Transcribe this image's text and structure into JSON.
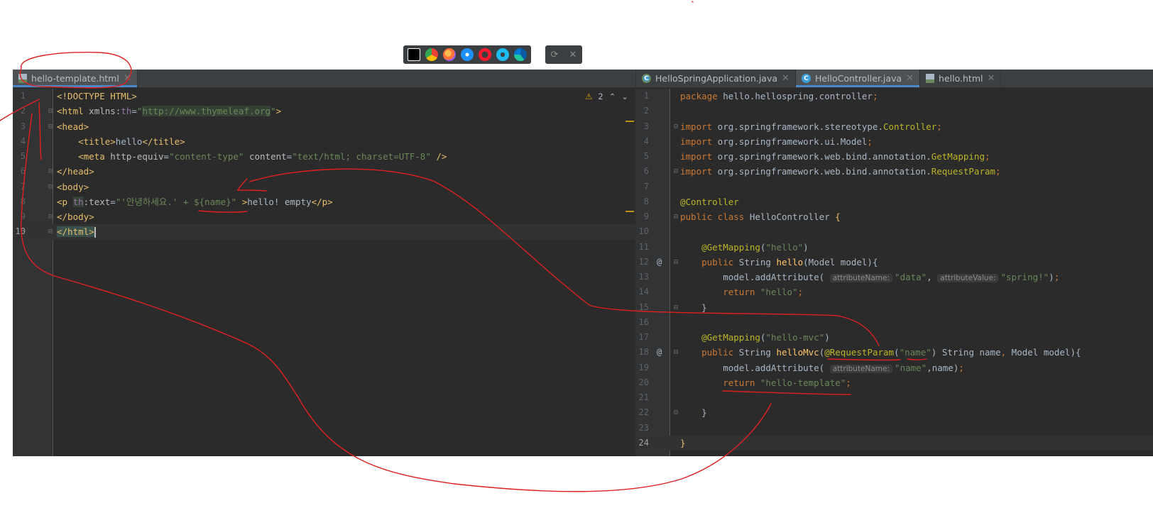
{
  "left_pane": {
    "tabs": [
      {
        "label": "hello-template.html",
        "icon": "html-file-icon",
        "active": true
      }
    ],
    "inspection": {
      "warning_count": "2"
    },
    "lines": [
      {
        "n": "1",
        "html": "<span class='tag'>&lt;!DOCTYPE HTML&gt;</span>"
      },
      {
        "n": "2",
        "html": "<span class='tag'>&lt;html</span> <span class='attr'>xmlns:</span><span class='ns'>th</span>=<span class='str'>\"<span class='hl-green'>http://www.thymeleaf.org</span>\"</span><span class='tag'>&gt;</span>"
      },
      {
        "n": "3",
        "html": "<span class='tag'>&lt;head&gt;</span>"
      },
      {
        "n": "4",
        "html": "    <span class='tag'>&lt;title&gt;</span>hello<span class='tag'>&lt;/title&gt;</span>"
      },
      {
        "n": "5",
        "html": "    <span class='tag'>&lt;meta</span> <span class='attr'>http-equiv</span>=<span class='str'>\"content-type\"</span> <span class='attr'>content</span>=<span class='str'>\"text/html; charset=UTF-8\"</span> <span class='tag'>/&gt;</span>"
      },
      {
        "n": "6",
        "html": "<span class='tag'>&lt;/head&gt;</span>"
      },
      {
        "n": "7",
        "html": "<span class='tag'>&lt;body&gt;</span>"
      },
      {
        "n": "8",
        "html": "<span class='tag'>&lt;p</span> <span class='ns hl-green'>th</span><span class='attr'>:text</span>=<span class='str'>\"'안녕하세요.' + ${name}\"</span> <span class='tag'>&gt;</span>hello! empty<span class='tag'>&lt;/p&gt;</span>"
      },
      {
        "n": "9",
        "html": "<span class='tag'>&lt;/body&gt;</span>"
      },
      {
        "n": "10",
        "html": "<span class='tag hl-name'>&lt;/html&gt;</span><span class='caret'></span>",
        "current": true
      }
    ]
  },
  "right_pane": {
    "tabs": [
      {
        "label": "HelloSpringApplication.java",
        "icon": "spring-app-icon",
        "active": false
      },
      {
        "label": "HelloController.java",
        "icon": "java-class-icon",
        "active": true
      },
      {
        "label": "hello.html",
        "icon": "html-file-icon",
        "active": false
      }
    ],
    "lines": [
      {
        "n": "1",
        "html": "<span class='kw'>package</span> hello.hellospring.controller<span class='kw'>;</span>"
      },
      {
        "n": "2",
        "html": ""
      },
      {
        "n": "3",
        "html": "<span class='kw'>import</span> org.springframework.stereotype.<span class='ann'>Controller</span><span class='kw'>;</span>"
      },
      {
        "n": "4",
        "html": "<span class='kw'>import</span> org.springframework.ui.Model<span class='kw'>;</span>"
      },
      {
        "n": "5",
        "html": "<span class='kw'>import</span> org.springframework.web.bind.annotation.<span class='ann'>GetMapping</span><span class='kw'>;</span>"
      },
      {
        "n": "6",
        "html": "<span class='kw'>import</span> org.springframework.web.bind.annotation.<span class='ann'>RequestParam</span><span class='kw'>;</span>"
      },
      {
        "n": "7",
        "html": ""
      },
      {
        "n": "8",
        "html": "<span class='ann'>@Controller</span>"
      },
      {
        "n": "9",
        "html": "<span class='kw'>public class</span> HelloController <span class='tag'>{</span>"
      },
      {
        "n": "10",
        "html": ""
      },
      {
        "n": "11",
        "html": "    <span class='ann'>@GetMapping</span>(<span class='str'>\"hello\"</span>)"
      },
      {
        "n": "12",
        "html": "    <span class='kw'>public</span> String <span style='color:#ffc66d'>hello</span>(Model model){",
        "at": true
      },
      {
        "n": "13",
        "html": "        model.addAttribute( <span class='hint'>attributeName:</span><span class='str'>\"data\"</span>, <span class='hint'>attributeValue:</span><span class='str'>\"spring!\"</span>)<span class='kw'>;</span>"
      },
      {
        "n": "14",
        "html": "        <span class='kw'>return</span> <span class='str'>\"hello\"</span><span class='kw'>;</span>"
      },
      {
        "n": "15",
        "html": "    }"
      },
      {
        "n": "16",
        "html": ""
      },
      {
        "n": "17",
        "html": "    <span class='ann'>@GetMapping</span>(<span class='str'>\"hello-mvc\"</span>)"
      },
      {
        "n": "18",
        "html": "    <span class='kw'>public</span> String <span style='color:#ffc66d'>helloMvc</span>(<span class='ann'>@RequestParam</span>(<span class='str'>\"name\"</span>) String name<span class='kw'>,</span> Model model){",
        "at": true
      },
      {
        "n": "19",
        "html": "        model.addAttribute( <span class='hint'>attributeName:</span><span class='str'>\"name\"</span>,name)<span class='kw'>;</span>"
      },
      {
        "n": "20",
        "html": "        <span class='kw'>return</span> <span class='str'>\"hello-template\"</span><span class='kw'>;</span>"
      },
      {
        "n": "21",
        "html": ""
      },
      {
        "n": "22",
        "html": "    }"
      },
      {
        "n": "23",
        "html": ""
      },
      {
        "n": "24",
        "html": "<span class='tag'>}</span>",
        "current": true
      }
    ]
  },
  "browser_icons": [
    "intellij-icon",
    "chrome-icon",
    "firefox-icon",
    "safari-icon",
    "opera-icon",
    "ie-icon",
    "edge-icon"
  ],
  "colors": {
    "editor_bg": "#2b2b2b",
    "tabbar_bg": "#3c3f41",
    "annotation_red": "#e02020"
  }
}
